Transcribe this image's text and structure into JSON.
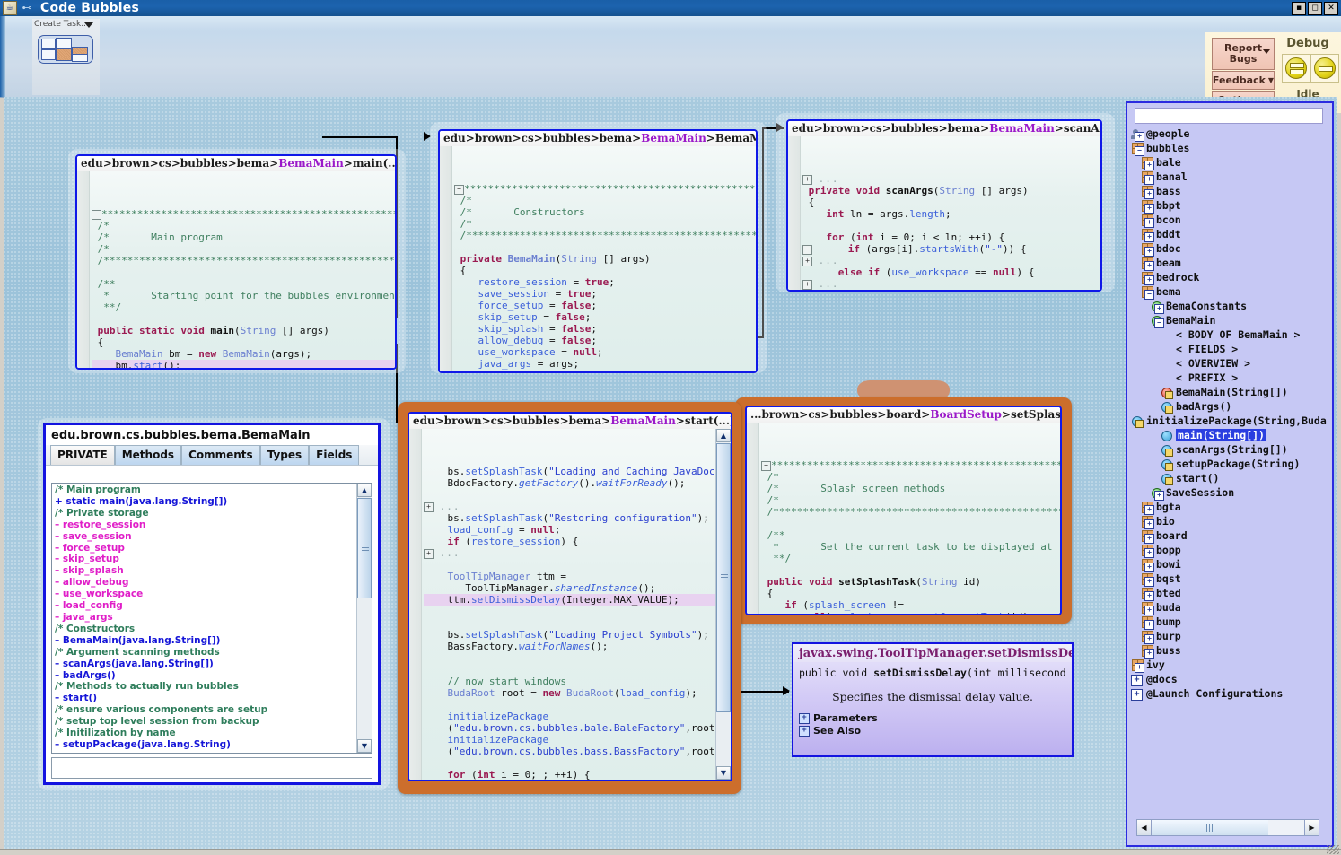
{
  "window": {
    "title": "Code Bubbles",
    "minimize": "▪",
    "maximize": "◻",
    "close": "✕"
  },
  "toolbar": {
    "create_task_label": "Create Task...",
    "report_bugs": "Report\nBugs",
    "report_bugs_line1": "Report",
    "report_bugs_line2": "Bugs",
    "feedback": "Feedback",
    "options": "Options",
    "debug_title": "Debug",
    "debug_status": "Idle",
    "debug_icon_1": "pause-resume-icon",
    "debug_icon_2": "step-icon"
  },
  "bubbles": {
    "main": {
      "header": {
        "prefix": "edu>brown>cs>bubbles>bema>",
        "class": "BemaMain",
        "suffix": ">main(...)"
      },
      "code": "/***********************************************************\n/*                                                          \n/*      Main program                                        \n/*                                                          \n/***********************************************************\n\n/**\n *      Starting point for the bubbles environment.\n **/\n\npublic static void main(String [] args)\n{\n   BemaMain bm = new BemaMain(args);\n\n   bm.start();\n}"
    },
    "ctor": {
      "header": {
        "prefix": "edu>brown>cs>bubbles>bema>",
        "class": "BemaMain",
        "suffix": ">BemaMain(...)"
      },
      "code": "/***********************************************************\n/*                                                          \n/*      Constructors                                        \n/*                                                          \n/***********************************************************\n\nprivate BemaMain(String [] args)\n{\n   restore_session = true;\n   save_session = true;\n   force_setup = false;\n   skip_setup = false;\n   skip_splash = false;\n   allow_debug = false;\n   use_workspace = null;\n   java_args = args;\n\n   scanArgs(args);\n}"
    },
    "scanargs": {
      "header": {
        "prefix": "edu>brown>cs>bubbles>bema>",
        "class": "BemaMain",
        "suffix": ">scanArgs(...)"
      },
      "code": "private void scanArgs(String [] args)\n{\n   int ln = args.length;\n\n   for (int i = 0; i < ln; ++i) {\n      if (args[i].startsWith(\"-\")) {\n      else if (use_workspace == null) {\n      else badArgs();\n    }\n }"
    },
    "start": {
      "header": {
        "prefix": "edu>brown>cs>bubbles>bema>",
        "class": "BemaMain",
        "suffix": ">start(...)"
      }
    },
    "splash": {
      "header": {
        "prefix": "...brown>cs>bubbles>board>",
        "class": "BoardSetup",
        "suffix": ">setSplashTask(...)"
      }
    }
  },
  "javadoc": {
    "title": "javax.swing.ToolTipManager.setDismissDelay",
    "signature_pre": "public void ",
    "signature_name": "setDismissDelay",
    "signature_post": "(int millisecond",
    "description": "Specifies the dismissal delay value.",
    "links": [
      "Parameters",
      "See Also"
    ]
  },
  "outline_panel": {
    "title": "edu.brown.cs.bubbles.bema.BemaMain",
    "tabs": [
      "PRIVATE",
      "Methods",
      "Comments",
      "Types",
      "Fields"
    ],
    "active_tab": "PRIVATE",
    "rows": [
      {
        "kind": "cmt",
        "text": "/* Main program"
      },
      {
        "kind": "meth",
        "text": "+ static main(java.lang.String[])"
      },
      {
        "kind": "cmt",
        "text": "/* Private storage"
      },
      {
        "kind": "fieldp",
        "text": "– restore_session"
      },
      {
        "kind": "fieldp",
        "text": "– save_session"
      },
      {
        "kind": "fieldp",
        "text": "– force_setup"
      },
      {
        "kind": "fieldp",
        "text": "– skip_setup"
      },
      {
        "kind": "fieldp",
        "text": "– skip_splash"
      },
      {
        "kind": "fieldp",
        "text": "– allow_debug"
      },
      {
        "kind": "fieldp",
        "text": "– use_workspace"
      },
      {
        "kind": "fieldp",
        "text": "– load_config"
      },
      {
        "kind": "fieldp",
        "text": "– java_args"
      },
      {
        "kind": "cmt",
        "text": "/* Constructors"
      },
      {
        "kind": "meth",
        "text": "– BemaMain(java.lang.String[])"
      },
      {
        "kind": "cmt",
        "text": "/* Argument scanning methods"
      },
      {
        "kind": "meth",
        "text": "– scanArgs(java.lang.String[])"
      },
      {
        "kind": "meth",
        "text": "– badArgs()"
      },
      {
        "kind": "cmt",
        "text": "/* Methods to actually run bubbles"
      },
      {
        "kind": "meth",
        "text": "– start()"
      },
      {
        "kind": "cmt",
        "text": "/* ensure various components are setup"
      },
      {
        "kind": "cmt",
        "text": "/* setup top level session from backup"
      },
      {
        "kind": "cmt",
        "text": "/* Initilization by name"
      },
      {
        "kind": "meth",
        "text": "– setupPackage(java.lang.String)"
      }
    ],
    "filter_value": ""
  },
  "sidebar": {
    "search_value": "",
    "tree": [
      {
        "indent": 0,
        "icon": "people-icon",
        "label": "@people"
      },
      {
        "indent": 0,
        "icon": "package-open-icon",
        "label": "bubbles"
      },
      {
        "indent": 1,
        "icon": "package-icon",
        "label": "bale"
      },
      {
        "indent": 1,
        "icon": "package-icon",
        "label": "banal"
      },
      {
        "indent": 1,
        "icon": "package-icon",
        "label": "bass"
      },
      {
        "indent": 1,
        "icon": "package-icon",
        "label": "bbpt"
      },
      {
        "indent": 1,
        "icon": "package-icon",
        "label": "bcon"
      },
      {
        "indent": 1,
        "icon": "package-icon",
        "label": "bddt"
      },
      {
        "indent": 1,
        "icon": "package-icon",
        "label": "bdoc"
      },
      {
        "indent": 1,
        "icon": "package-icon",
        "label": "beam"
      },
      {
        "indent": 1,
        "icon": "package-icon",
        "label": "bedrock"
      },
      {
        "indent": 1,
        "icon": "package-open-icon",
        "label": "bema"
      },
      {
        "indent": 2,
        "icon": "interface-icon",
        "label": "BemaConstants"
      },
      {
        "indent": 2,
        "icon": "class-open-icon",
        "label": "BemaMain"
      },
      {
        "indent": 3,
        "icon": "none",
        "label": "< BODY OF BemaMain >"
      },
      {
        "indent": 3,
        "icon": "none",
        "label": "< FIELDS >"
      },
      {
        "indent": 3,
        "icon": "none",
        "label": "< OVERVIEW >"
      },
      {
        "indent": 3,
        "icon": "none",
        "label": "< PREFIX >"
      },
      {
        "indent": 3,
        "icon": "method-private-red-icon",
        "label": "BemaMain(String[])"
      },
      {
        "indent": 3,
        "icon": "method-private-icon",
        "label": "badArgs()"
      },
      {
        "indent": 3,
        "icon": "method-private-icon",
        "label": "initializePackage(String,Budal"
      },
      {
        "indent": 3,
        "icon": "method-public-icon",
        "label": "main(String[])",
        "selected": true
      },
      {
        "indent": 3,
        "icon": "method-private-icon",
        "label": "scanArgs(String[])"
      },
      {
        "indent": 3,
        "icon": "method-private-icon",
        "label": "setupPackage(String)"
      },
      {
        "indent": 3,
        "icon": "method-private-icon",
        "label": "start()"
      },
      {
        "indent": 2,
        "icon": "interface-icon",
        "label": "SaveSession"
      },
      {
        "indent": 1,
        "icon": "package-icon",
        "label": "bgta"
      },
      {
        "indent": 1,
        "icon": "package-icon",
        "label": "bio"
      },
      {
        "indent": 1,
        "icon": "package-icon",
        "label": "board"
      },
      {
        "indent": 1,
        "icon": "package-icon",
        "label": "bopp"
      },
      {
        "indent": 1,
        "icon": "package-icon",
        "label": "bowi"
      },
      {
        "indent": 1,
        "icon": "package-icon",
        "label": "bqst"
      },
      {
        "indent": 1,
        "icon": "package-icon",
        "label": "bted"
      },
      {
        "indent": 1,
        "icon": "package-icon",
        "label": "buda"
      },
      {
        "indent": 1,
        "icon": "package-icon",
        "label": "bump"
      },
      {
        "indent": 1,
        "icon": "package-icon",
        "label": "burp"
      },
      {
        "indent": 1,
        "icon": "package-icon",
        "label": "buss"
      },
      {
        "indent": 0,
        "icon": "package-icon",
        "label": "ivy"
      },
      {
        "indent": 0,
        "icon": "plus-box-icon",
        "label": "@docs"
      },
      {
        "indent": 0,
        "icon": "plus-box-icon",
        "label": "@Launch Configurations"
      }
    ]
  }
}
